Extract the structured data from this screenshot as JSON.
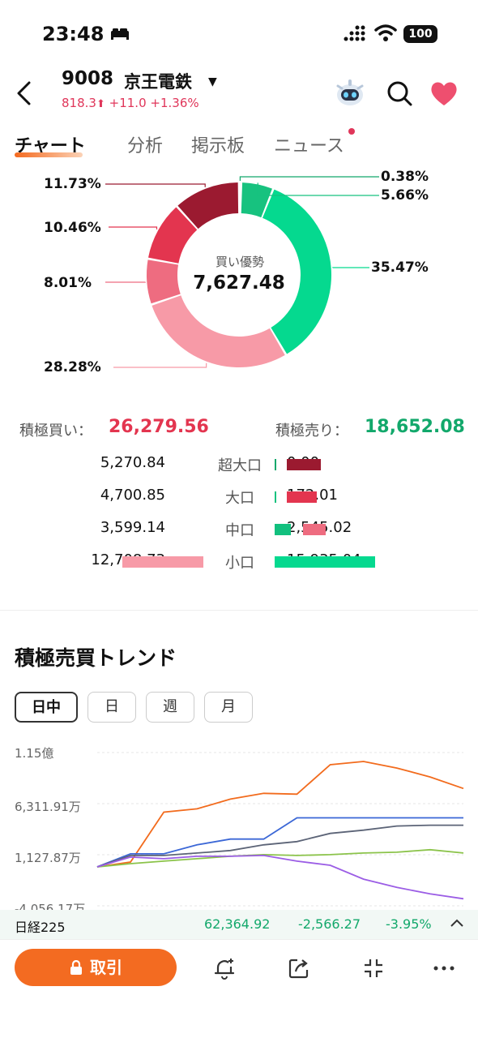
{
  "status": {
    "time": "23:48",
    "battery": "100"
  },
  "header": {
    "code": "9008",
    "name": "京王電鉄",
    "price": "818.3",
    "change": "+11.0",
    "change_pct": "+1.36%"
  },
  "tabs": [
    "チャート",
    "分析",
    "掲示板",
    "ニュース"
  ],
  "donut": {
    "center_label": "買い優勢",
    "center_value": "7,627.48",
    "segments": [
      {
        "label": "0.38%",
        "value": 0.38,
        "color": "#12a86b"
      },
      {
        "label": "5.66%",
        "value": 5.66,
        "color": "#17c27f"
      },
      {
        "label": "35.47%",
        "value": 35.47,
        "color": "#05d98f"
      },
      {
        "label": "28.28%",
        "value": 28.28,
        "color": "#f79aa7"
      },
      {
        "label": "8.01%",
        "value": 8.01,
        "color": "#ee6c80"
      },
      {
        "label": "10.46%",
        "value": 10.46,
        "color": "#e3354f"
      },
      {
        "label": "11.73%",
        "value": 11.73,
        "color": "#9b1a30"
      }
    ]
  },
  "summary": {
    "buy_label": "積極買い：",
    "buy_value": "26,279.56",
    "sell_label": "積極売り：",
    "sell_value": "18,652.08"
  },
  "breakdown": [
    {
      "buy": "5,270.84",
      "category": "超大口",
      "sell": "0.00",
      "buy_ratio": 0.415,
      "sell_ratio": 0.0,
      "buy_color": "#9b1a30",
      "sell_color": "#12a86b"
    },
    {
      "buy": "4,700.85",
      "category": "大口",
      "sell": "172.01",
      "buy_ratio": 0.37,
      "sell_ratio": 0.011,
      "buy_color": "#e3354f",
      "sell_color": "#17c27f"
    },
    {
      "buy": "3,599.14",
      "category": "中口",
      "sell": "2,545.02",
      "buy_ratio": 0.283,
      "sell_ratio": 0.16,
      "buy_color": "#ee6c80",
      "sell_color": "#12c07e"
    },
    {
      "buy": "12,708.73",
      "category": "小口",
      "sell": "15,935.04",
      "buy_ratio": 1.0,
      "sell_ratio": 1.0,
      "buy_color": "#f79aa7",
      "sell_color": "#05d98f"
    }
  ],
  "trend": {
    "title": "積極売買トレンド",
    "periods": [
      "日中",
      "日",
      "週",
      "月"
    ],
    "active_period": "日中"
  },
  "chart_data": {
    "type": "line",
    "ytick_labels": [
      "1.15億",
      "6,311.91万",
      "1,127.87万",
      "-4,056.17万"
    ],
    "series": [
      {
        "color": "#f26b1d",
        "values": [
          0,
          600,
          6700,
          7100,
          8300,
          9000,
          8900,
          12500,
          12900,
          12100,
          11000,
          9600
        ]
      },
      {
        "color": "#3b67d6",
        "values": [
          0,
          1600,
          1600,
          2700,
          3400,
          3400,
          6000,
          6000,
          6000,
          6000,
          6000,
          6000
        ]
      },
      {
        "color": "#5c6477",
        "values": [
          0,
          1400,
          1400,
          1700,
          2000,
          2700,
          3100,
          4100,
          4500,
          5000,
          5100,
          5100
        ]
      },
      {
        "color": "#8bc34a",
        "values": [
          0,
          400,
          700,
          1000,
          1300,
          1500,
          1400,
          1500,
          1700,
          1800,
          2100,
          1700
        ]
      },
      {
        "color": "#9b5de5",
        "values": [
          0,
          1200,
          1000,
          1300,
          1300,
          1400,
          700,
          200,
          -1500,
          -2500,
          -3300,
          -3900
        ]
      }
    ]
  },
  "ticker": {
    "name": "日経225",
    "value": "62,364.92",
    "change": "-2,566.27",
    "pct": "-3.95%"
  },
  "bottom": {
    "trade_label": "取引"
  }
}
